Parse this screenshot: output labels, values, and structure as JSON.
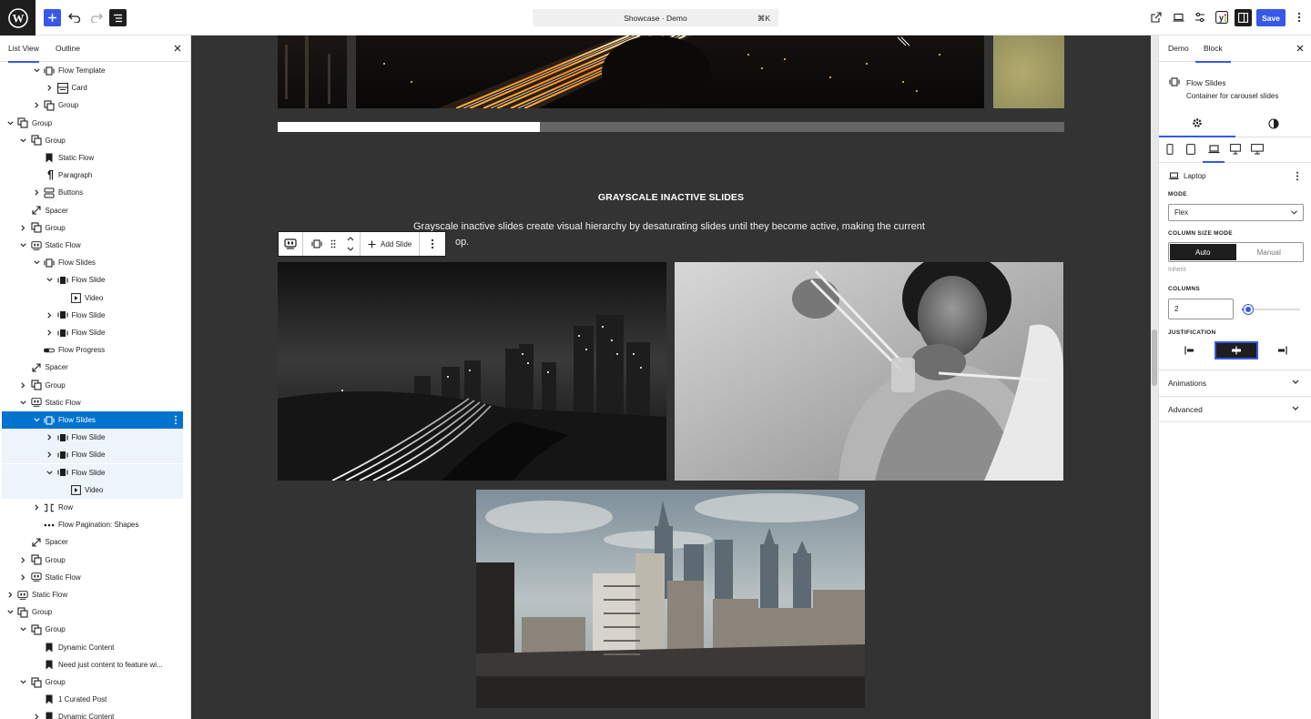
{
  "topbar": {
    "command_title": "Showcase · Demo",
    "command_shortcut": "⌘K",
    "save_label": "Save",
    "colors": {
      "accent": "#3858e9",
      "dark": "#1e1e1e"
    }
  },
  "left_panel": {
    "tabs": [
      "List View",
      "Outline"
    ],
    "tree": [
      {
        "label": "Flow Template",
        "icon": "flow-slides-icon",
        "indent": 2,
        "chev": "down"
      },
      {
        "label": "Card",
        "icon": "card-icon",
        "indent": 3,
        "chev": "right"
      },
      {
        "label": "Group",
        "icon": "group-icon",
        "indent": 2,
        "chev": "right"
      },
      {
        "label": "Group",
        "icon": "group-icon",
        "indent": 0,
        "chev": "down"
      },
      {
        "label": "Group",
        "icon": "group-icon",
        "indent": 1,
        "chev": "down"
      },
      {
        "label": "Static Flow",
        "icon": "bookmark-icon",
        "indent": 2,
        "chev": ""
      },
      {
        "label": "Paragraph",
        "icon": "paragraph-icon",
        "indent": 2,
        "chev": ""
      },
      {
        "label": "Buttons",
        "icon": "buttons-icon",
        "indent": 2,
        "chev": "right"
      },
      {
        "label": "Spacer",
        "icon": "spacer-icon",
        "indent": 1,
        "chev": ""
      },
      {
        "label": "Group",
        "icon": "group-icon",
        "indent": 1,
        "chev": "right"
      },
      {
        "label": "Static Flow",
        "icon": "static-flow-icon",
        "indent": 1,
        "chev": "down"
      },
      {
        "label": "Flow Slides",
        "icon": "flow-slides-icon",
        "indent": 2,
        "chev": "down"
      },
      {
        "label": "Flow Slide",
        "icon": "flow-slide-icon",
        "indent": 3,
        "chev": "down"
      },
      {
        "label": "Video",
        "icon": "video-icon",
        "indent": 4,
        "chev": ""
      },
      {
        "label": "Flow Slide",
        "icon": "flow-slide-icon",
        "indent": 3,
        "chev": "right"
      },
      {
        "label": "Flow Slide",
        "icon": "flow-slide-icon",
        "indent": 3,
        "chev": "right"
      },
      {
        "label": "Flow Progress",
        "icon": "progress-icon",
        "indent": 2,
        "chev": ""
      },
      {
        "label": "Spacer",
        "icon": "spacer-icon",
        "indent": 1,
        "chev": ""
      },
      {
        "label": "Group",
        "icon": "group-icon",
        "indent": 1,
        "chev": "right"
      },
      {
        "label": "Static Flow",
        "icon": "static-flow-icon",
        "indent": 1,
        "chev": "down"
      },
      {
        "label": "Flow Slides",
        "icon": "flow-slides-icon",
        "indent": 2,
        "chev": "down",
        "state": "selected"
      },
      {
        "label": "Flow Slide",
        "icon": "flow-slide-icon",
        "indent": 3,
        "chev": "right",
        "state": "sub"
      },
      {
        "label": "Flow Slide",
        "icon": "flow-slide-icon",
        "indent": 3,
        "chev": "right",
        "state": "sub"
      },
      {
        "label": "Flow Slide",
        "icon": "flow-slide-icon",
        "indent": 3,
        "chev": "down",
        "state": "sub"
      },
      {
        "label": "Video",
        "icon": "video-icon",
        "indent": 4,
        "chev": "",
        "state": "sub"
      },
      {
        "label": "Row",
        "icon": "row-icon",
        "indent": 2,
        "chev": "right"
      },
      {
        "label": "Flow Pagination: Shapes",
        "icon": "dots-icon",
        "indent": 2,
        "chev": ""
      },
      {
        "label": "Spacer",
        "icon": "spacer-icon",
        "indent": 1,
        "chev": ""
      },
      {
        "label": "Group",
        "icon": "group-icon",
        "indent": 1,
        "chev": "right"
      },
      {
        "label": "Static Flow",
        "icon": "static-flow-icon",
        "indent": 1,
        "chev": "right"
      },
      {
        "label": "Static Flow",
        "icon": "static-flow-icon",
        "indent": 0,
        "chev": "right"
      },
      {
        "label": "Group",
        "icon": "group-icon",
        "indent": 0,
        "chev": "down"
      },
      {
        "label": "Group",
        "icon": "group-icon",
        "indent": 1,
        "chev": "down"
      },
      {
        "label": "Dynamic Content",
        "icon": "bookmark-icon",
        "indent": 2,
        "chev": ""
      },
      {
        "label": "Need just content to feature wi...",
        "icon": "bookmark-icon",
        "indent": 2,
        "chev": ""
      },
      {
        "label": "Group",
        "icon": "group-icon",
        "indent": 1,
        "chev": "down"
      },
      {
        "label": "1 Curated Post",
        "icon": "bookmark-icon",
        "indent": 2,
        "chev": ""
      },
      {
        "label": "Dynamic Content",
        "icon": "bookmark-icon",
        "indent": 2,
        "chev": "right"
      }
    ]
  },
  "canvas": {
    "section_title": "GRAYSCALE INACTIVE SLIDES",
    "section_desc_line1": "Grayscale inactive slides create visual hierarchy by desaturating slides until they become active, making the current",
    "section_desc_line2": "op.",
    "progress_fraction": 0.333,
    "toolbar": {
      "add_slide_label": "Add Slide"
    }
  },
  "right_panel": {
    "tabs": [
      "Demo",
      "Block"
    ],
    "block_title": "Flow Slides",
    "block_desc": "Container for carousel slides",
    "breakpoint": "Laptop",
    "mode_label": "MODE",
    "mode_value": "Flex",
    "column_size_label": "COLUMN SIZE MODE",
    "column_size_options": [
      "Auto",
      "Manual"
    ],
    "inherit_text": "Inherit",
    "columns_label": "COLUMNS",
    "columns_value": "2",
    "justification_label": "JUSTIFICATION",
    "panels": [
      "Animations",
      "Advanced"
    ]
  }
}
